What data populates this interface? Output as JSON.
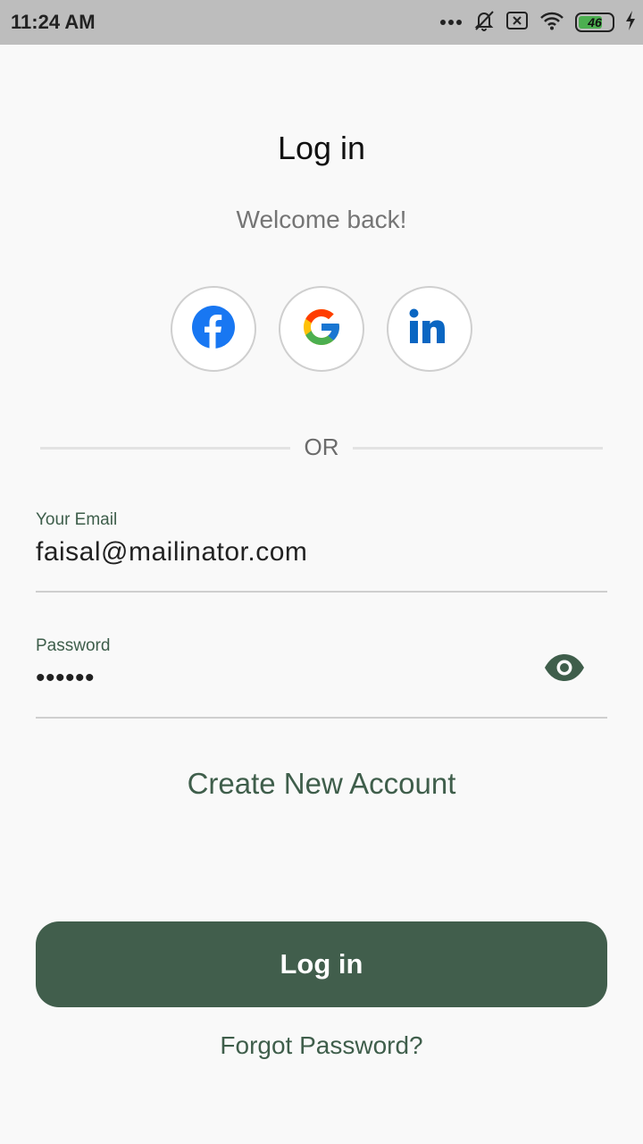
{
  "status_bar": {
    "time": "11:24 AM",
    "battery_level": "46",
    "icons": [
      "more-dots-icon",
      "bell-off-icon",
      "sim-x-icon",
      "wifi-icon",
      "battery-icon",
      "charging-bolt-icon"
    ]
  },
  "header": {
    "title": "Log in",
    "subtitle": "Welcome back!"
  },
  "social": {
    "buttons": [
      {
        "name": "facebook",
        "icon": "facebook-icon",
        "color": "#1877f2"
      },
      {
        "name": "google",
        "icon": "google-icon",
        "color": "#4285f4"
      },
      {
        "name": "linkedin",
        "icon": "linkedin-icon",
        "color": "#0a66c2"
      }
    ]
  },
  "divider": {
    "text": "OR"
  },
  "form": {
    "email": {
      "label": "Your Email",
      "value": "faisal@mailinator.com"
    },
    "password": {
      "label": "Password",
      "value": "••••••",
      "toggle_icon": "eye-icon"
    }
  },
  "links": {
    "create_account": "Create New Account",
    "forgot_password": "Forgot Password?"
  },
  "actions": {
    "login_label": "Log in"
  },
  "colors": {
    "accent": "#415e4c",
    "background": "#f9f9f9",
    "status_bar": "#bdbdbd"
  }
}
